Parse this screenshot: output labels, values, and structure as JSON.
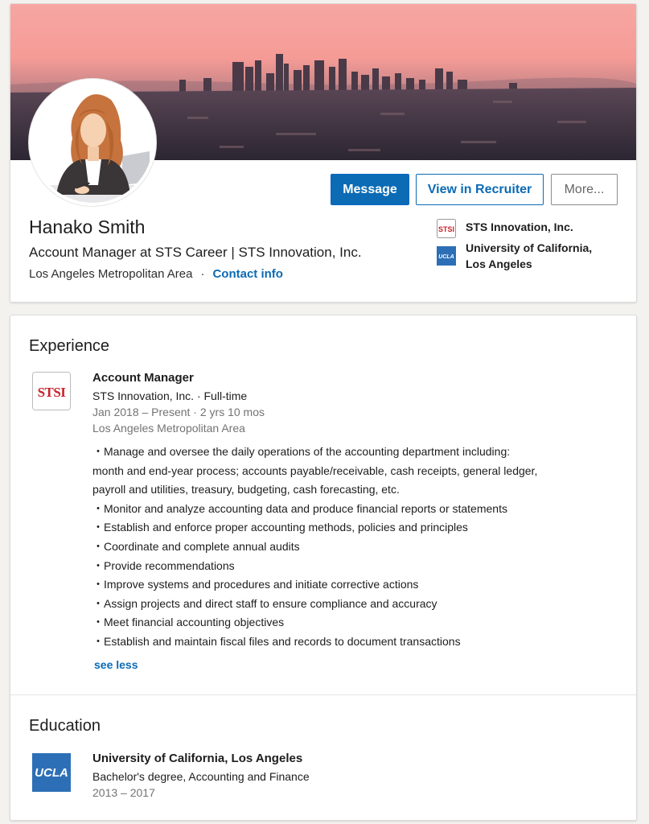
{
  "profile": {
    "name": "Hanako Smith",
    "headline": "Account Manager at STS Career | STS Innovation, Inc.",
    "location": "Los Angeles Metropolitan Area",
    "separator": "·",
    "contact_label": "Contact info"
  },
  "actions": {
    "message": "Message",
    "recruiter": "View in Recruiter",
    "more": "More..."
  },
  "affiliations": [
    {
      "name": "STS Innovation, Inc.",
      "logo": "STSI"
    },
    {
      "name": "University of California, Los Angeles",
      "logo": "UCLA"
    }
  ],
  "experience": {
    "heading": "Experience",
    "title": "Account Manager",
    "company": "STS Innovation, Inc. · Full-time",
    "dates": "Jan 2018 – Present · 2 yrs 10 mos",
    "location": "Los Angeles Metropolitan Area",
    "logo": "STSI",
    "description": [
      "・Manage and oversee the daily operations of the accounting department including:",
      "month and end-year process; accounts payable/receivable, cash receipts, general ledger,",
      "payroll and utilities, treasury, budgeting, cash forecasting, etc.",
      "・Monitor and analyze accounting data and produce financial reports or statements",
      "・Establish and enforce proper accounting methods, policies and principles",
      "・Coordinate and complete annual audits",
      "・Provide recommendations",
      "・Improve systems and procedures and initiate corrective actions",
      "・Assign projects and direct staff to ensure compliance and accuracy",
      "・Meet financial accounting objectives",
      "・Establish and maintain fiscal files and records to document transactions"
    ],
    "see_less": "see less"
  },
  "education": {
    "heading": "Education",
    "school": "University of California, Los Angeles",
    "degree": "Bachelor's degree, Accounting and Finance",
    "years": "2013 – 2017",
    "logo": "UCLA"
  },
  "colors": {
    "link": "#0b6bb5",
    "primary_button": "#0b6bb5",
    "ucla_blue": "#2d6fb7",
    "stsi_red": "#c8232c"
  }
}
